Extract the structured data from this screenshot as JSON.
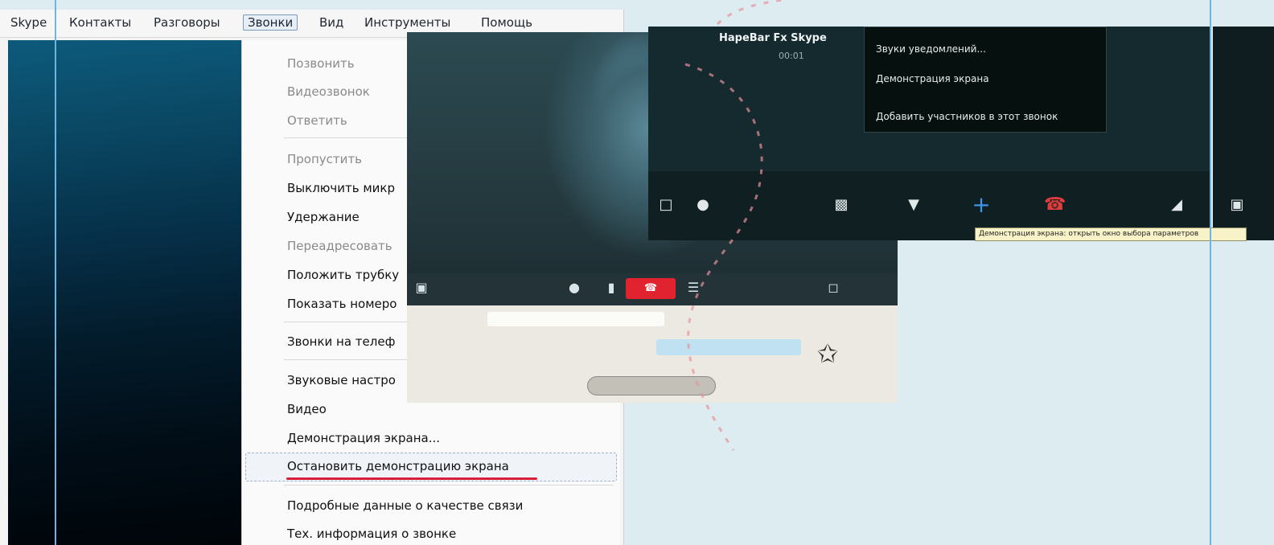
{
  "menubar": {
    "items": [
      "Skype",
      "Контакты",
      "Разговоры",
      "Звонки",
      "Вид",
      "Инструменты",
      "Помощь"
    ]
  },
  "calls_menu": {
    "items": [
      {
        "label": "Позвонить",
        "disabled": true
      },
      {
        "label": "Видеозвонок",
        "disabled": true
      },
      {
        "label": "Ответить",
        "disabled": true
      },
      {
        "label": "Пропустить",
        "disabled": true
      },
      {
        "label": "Выключить микр",
        "disabled": false
      },
      {
        "label": "Удержание",
        "disabled": false
      },
      {
        "label": "Переадресовать",
        "disabled": true
      },
      {
        "label": "Положить трубку",
        "disabled": false
      },
      {
        "label": "Показать номеро",
        "disabled": false
      },
      {
        "label": "Звонки на телеф",
        "disabled": false
      },
      {
        "label": "Звуковые настро",
        "disabled": false
      },
      {
        "label": "Видео",
        "disabled": false
      },
      {
        "label": "Демонстрация экрана...",
        "disabled": false
      },
      {
        "label": "Остановить демонстрацию экрана",
        "disabled": false
      },
      {
        "label": "Подробные данные о качестве связи",
        "disabled": false
      },
      {
        "label": "Тех. информация о звонке",
        "disabled": false
      }
    ]
  },
  "share_panel": {
    "contact_name": "HapeBar Fx Skype",
    "call_time": "00:01",
    "popup_items": [
      "Звуки уведомлений...",
      "Демонстрация экрана",
      "Добавить участников в этот звонок"
    ],
    "tooltip": "Демонстрация экрана: открыть окно выбора параметров"
  },
  "colors": {
    "page_bg": "#dcecf0",
    "guide_line": "#6fb3e0",
    "underline_accent": "#d91e3c",
    "end_call": "#e0232e",
    "add_call_plus": "#3d94e8"
  },
  "icons": {
    "share_toolbar": [
      "chat-icon",
      "contacts-icon",
      "video-icon",
      "microphone-icon",
      "add-icon",
      "hang-up-icon",
      "signal-icon",
      "screen-icon"
    ],
    "video_toolbar": [
      "camera-icon",
      "volume-icon",
      "microphone-icon",
      "end-call-icon",
      "menu-icon",
      "fullscreen-icon"
    ]
  }
}
